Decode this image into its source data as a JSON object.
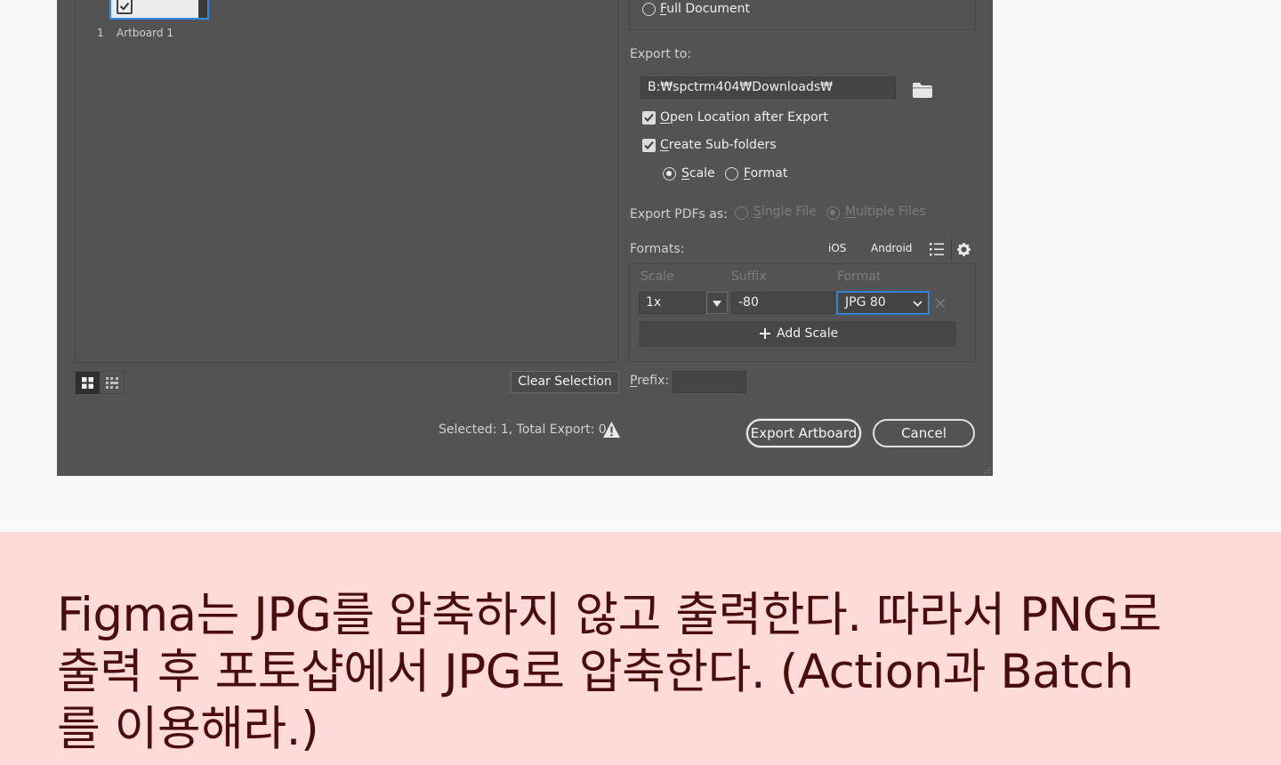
{
  "artboards": {
    "items": [
      {
        "number": "1",
        "name": "Artboard 1",
        "checked": true
      }
    ],
    "clear_selection_label": "Clear Selection",
    "view_grid_icon": "grid-view-icon",
    "view_list_icon": "list-view-icon"
  },
  "range": {
    "full_document_label_u": "F",
    "full_document_label": "ull Document",
    "full_document_selected": false
  },
  "export_to": {
    "label": "Export to:",
    "path": "B:₩spctrm404₩Downloads₩",
    "folder_icon": "folder-icon",
    "open_location_u": "O",
    "open_location_label": "pen Location after Export",
    "open_location_checked": true,
    "create_subfolders_u": "C",
    "create_subfolders_label": "reate Sub-folders",
    "create_subfolders_checked": true,
    "scale_u": "S",
    "scale_label": "cale",
    "scale_selected": true,
    "format_u": "F",
    "format_label": "ormat",
    "format_selected": false
  },
  "pdf": {
    "label": "Export PDFs as:",
    "single_u": "S",
    "single_label": "ingle File",
    "multiple_u": "M",
    "multiple_label": "ultiple Files",
    "multiple_selected": true
  },
  "formats": {
    "label": "Formats:",
    "ios_label": "iOS",
    "android_label": "Android",
    "list_icon": "list-icon",
    "gear_icon": "gear-icon",
    "columns": {
      "scale": "Scale",
      "suffix": "Suffix",
      "format": "Format"
    },
    "row": {
      "scale": "1x",
      "suffix": "-80",
      "format": "JPG 80"
    },
    "add_scale_label": "Add Scale",
    "prefix_u": "P",
    "prefix_label": "refix:",
    "prefix_value": ""
  },
  "status": {
    "text": "Selected: 1, Total Export: 0",
    "warning_icon": "warning-icon"
  },
  "buttons": {
    "export": "Export Artboard",
    "cancel": "Cancel"
  },
  "caption": {
    "line1": "Figma는 JPG를 압축하지 않고 출력한다. 따라서 PNG로",
    "line2": "출력 후 포토샵에서 JPG로 압축한다. (Action과 Batch",
    "line3": "를 이용해라.)"
  },
  "colors": {
    "dialog_bg": "#535353",
    "accent": "#2d8ceb",
    "caption_band": "#fedbd8",
    "caption_text": "#4a0d0d"
  }
}
